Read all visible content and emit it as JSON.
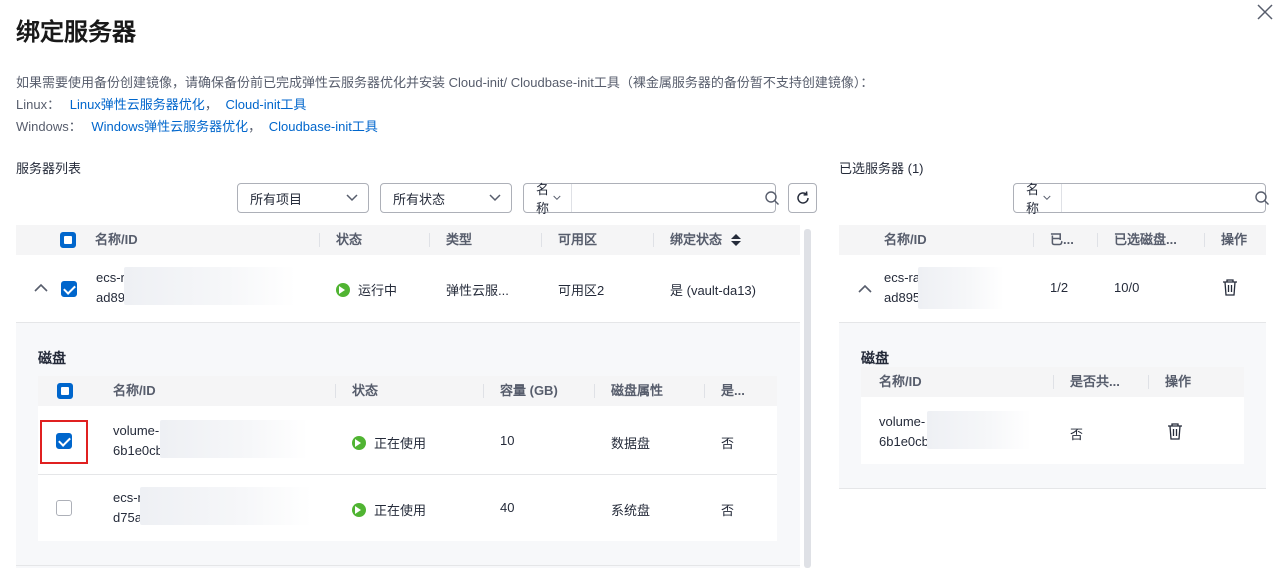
{
  "header": {
    "title": "绑定服务器"
  },
  "notes": {
    "line1": "如果需要使用备份创建镜像，请确保备份前已完成弹性云服务器优化并安装 Cloud-init/ Cloudbase-init工具（裸金属服务器的备份暂不支持创建镜像）：",
    "linux_prefix": "Linux：",
    "linux_link1": "Linux弹性云服务器优化",
    "linux_sep": "，",
    "linux_link2": "Cloud-init工具",
    "windows_prefix": "Windows：",
    "windows_link1": "Windows弹性云服务器优化",
    "windows_sep": "，",
    "windows_link2": "Cloudbase-init工具"
  },
  "server_list": {
    "label": "服务器列表",
    "filter_project": "所有项目",
    "filter_status": "所有状态",
    "search_field": "名称",
    "search_placeholder": "",
    "columns": [
      "名称/ID",
      "状态",
      "类型",
      "可用区",
      "绑定状态"
    ],
    "row": {
      "name": "ecs-r",
      "id": "ad89",
      "status": "运行中",
      "type": "弹性云服...",
      "az": "可用区2",
      "bind_status": "是 (vault-da13)"
    },
    "disk_section": {
      "label": "磁盘",
      "columns": [
        "名称/ID",
        "状态",
        "容量 (GB)",
        "磁盘属性",
        "是..."
      ],
      "rows": [
        {
          "name": "volume-(",
          "id": "6b1e0cb",
          "status": "正在使用",
          "capacity": "10",
          "attr": "数据盘",
          "shared": "否",
          "checked": true
        },
        {
          "name": "ecs-r",
          "id": "d75a1",
          "status": "正在使用",
          "capacity": "40",
          "attr": "系统盘",
          "shared": "否",
          "checked": false
        }
      ]
    }
  },
  "selected": {
    "label": "已选服务器 (1)",
    "search_field": "名称",
    "search_placeholder": "",
    "columns": [
      "名称/ID",
      "已...",
      "已选磁盘...",
      "操作"
    ],
    "row": {
      "name": "ecs-ra",
      "id": "ad895",
      "col2": "1/2",
      "col3": "10/0"
    },
    "disk_section": {
      "label": "磁盘",
      "columns": [
        "名称/ID",
        "是否共...",
        "操作"
      ],
      "row": {
        "name": "volume-",
        "id": "6b1e0cb",
        "shared": "否"
      }
    }
  },
  "colors": {
    "primary": "#0066cc",
    "running": "#50b432",
    "highlight": "#e02020"
  }
}
